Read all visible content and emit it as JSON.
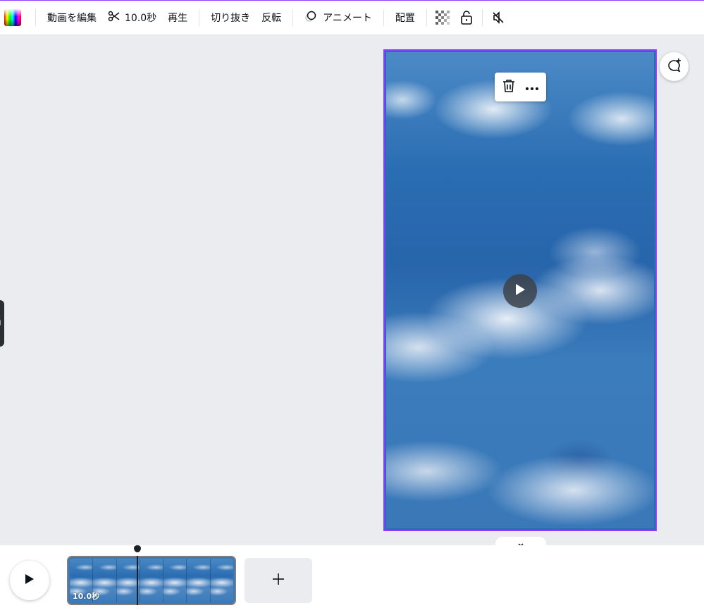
{
  "toolbar": {
    "color_icon": "color-wheel-icon",
    "edit_video": "動画を編集",
    "trim_icon": "scissors-icon",
    "duration": "10.0秒",
    "playback": "再生",
    "crop": "切り抜き",
    "flip": "反転",
    "animate_icon": "animate-circles-icon",
    "animate": "アニメート",
    "position": "配置",
    "transparency_icon": "checkerboard-icon",
    "lock_icon": "unlock-icon",
    "mute_icon": "speaker-muted-icon"
  },
  "floating_menu": {
    "delete_icon": "trash-icon",
    "more_icon": "more-dots-icon"
  },
  "canvas": {
    "play_icon": "play-icon",
    "comment_icon": "add-comment-icon",
    "collapse_icon": "chevron-down-icon"
  },
  "timeline": {
    "play_icon": "play-icon",
    "clip_duration": "10.0秒",
    "add_icon": "plus-icon"
  },
  "colors": {
    "accent": "#8b3dff",
    "canvas_bg": "#ebecf0",
    "toolbar_bg": "#ffffff"
  }
}
